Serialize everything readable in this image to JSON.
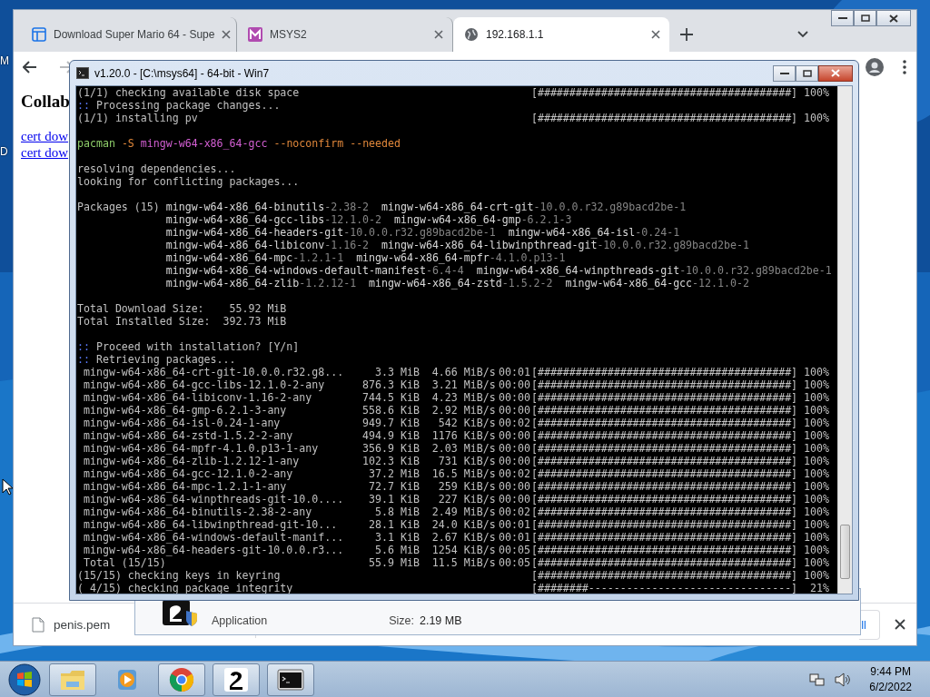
{
  "desktop": {
    "labels": [
      "M",
      "D"
    ]
  },
  "browser": {
    "tabs": [
      {
        "title": "Download Super Mario 64 - Supe",
        "kind": "page",
        "selected": false
      },
      {
        "title": "MSYS2",
        "kind": "msys",
        "selected": false
      },
      {
        "title": "192.168.1.1",
        "kind": "globe",
        "selected": true
      }
    ],
    "page": {
      "heading": "Collab",
      "links": [
        "cert dow",
        "cert dow"
      ]
    },
    "download_bar": {
      "file": "penis.pem",
      "button": "ll"
    }
  },
  "installer": {
    "type": "Application",
    "size_label": "Size:",
    "size": "2.19 MB"
  },
  "terminal": {
    "title": "v1.20.0 - [C:\\msys64] - 64-bit - Win7",
    "lines": [
      {
        "kind": "progress",
        "text": "(1/1) checking available disk space",
        "bar": "[########################################]",
        "percent": "100%"
      },
      {
        "kind": "info",
        "marker": "::",
        "text": "Processing package changes..."
      },
      {
        "kind": "progress",
        "text": "(1/1) installing pv",
        "bar": "[########################################]",
        "percent": "100%"
      },
      {
        "kind": "blank"
      },
      {
        "kind": "command",
        "segments": [
          {
            "text": "pacman",
            "color": "#8fcf6a"
          },
          {
            "text": "-S",
            "color": "#e0873a"
          },
          {
            "text": "mingw-w64-x86_64-gcc",
            "color": "#d35fd3"
          },
          {
            "text": "--noconfirm --needed",
            "color": "#e0873a"
          }
        ]
      },
      {
        "kind": "blank"
      },
      {
        "kind": "text",
        "text": "resolving dependencies..."
      },
      {
        "kind": "text",
        "text": "looking for conflicting packages..."
      },
      {
        "kind": "blank"
      },
      {
        "kind": "packages",
        "label": "Packages (15)",
        "rows": [
          [
            {
              "name": "mingw-w64-x86_64-binutils",
              "version": "-2.38-2"
            },
            {
              "name": "mingw-w64-x86_64-crt-git",
              "version": "-10.0.0.r32.g89bacd2be-1"
            }
          ],
          [
            {
              "name": "mingw-w64-x86_64-gcc-libs",
              "version": "-12.1.0-2"
            },
            {
              "name": "mingw-w64-x86_64-gmp",
              "version": "-6.2.1-3"
            }
          ],
          [
            {
              "name": "mingw-w64-x86_64-headers-git",
              "version": "-10.0.0.r32.g89bacd2be-1"
            },
            {
              "name": "mingw-w64-x86_64-isl",
              "version": "-0.24-1"
            }
          ],
          [
            {
              "name": "mingw-w64-x86_64-libiconv",
              "version": "-1.16-2"
            },
            {
              "name": "mingw-w64-x86_64-libwinpthread-git",
              "version": "-10.0.0.r32.g89bacd2be-1"
            }
          ],
          [
            {
              "name": "mingw-w64-x86_64-mpc",
              "version": "-1.2.1-1"
            },
            {
              "name": "mingw-w64-x86_64-mpfr",
              "version": "-4.1.0.p13-1"
            }
          ],
          [
            {
              "name": "mingw-w64-x86_64-windows-default-manifest",
              "version": "-6.4-4"
            },
            {
              "name": "mingw-w64-x86_64-winpthreads-git",
              "version": "-10.0.0.r32.g89bacd2be-1"
            }
          ],
          [
            {
              "name": "mingw-w64-x86_64-zlib",
              "version": "-1.2.12-1"
            },
            {
              "name": "mingw-w64-x86_64-zstd",
              "version": "-1.5.2-2"
            },
            {
              "name": "mingw-w64-x86_64-gcc",
              "version": "-12.1.0-2"
            }
          ]
        ]
      },
      {
        "kind": "blank"
      },
      {
        "kind": "size",
        "label": "Total Download Size:",
        "value": "55.92 MiB"
      },
      {
        "kind": "size",
        "label": "Total Installed Size:",
        "value": "392.73 MiB"
      },
      {
        "kind": "blank"
      },
      {
        "kind": "info",
        "marker": "::",
        "text": "Proceed with installation? [Y/n]"
      },
      {
        "kind": "info",
        "marker": "::",
        "text": "Retrieving packages..."
      },
      {
        "kind": "download",
        "name": "mingw-w64-x86_64-crt-git-10.0.0.r32.g8...",
        "size": "3.3 MiB",
        "speed": "4.66 MiB/s",
        "time": "00:01",
        "bar": "[########################################]",
        "percent": "100%"
      },
      {
        "kind": "download",
        "name": "mingw-w64-x86_64-gcc-libs-12.1.0-2-any",
        "size": "876.3 KiB",
        "speed": "3.21 MiB/s",
        "time": "00:00",
        "bar": "[########################################]",
        "percent": "100%"
      },
      {
        "kind": "download",
        "name": "mingw-w64-x86_64-libiconv-1.16-2-any",
        "size": "744.5 KiB",
        "speed": "4.23 MiB/s",
        "time": "00:00",
        "bar": "[########################################]",
        "percent": "100%"
      },
      {
        "kind": "download",
        "name": "mingw-w64-x86_64-gmp-6.2.1-3-any",
        "size": "558.6 KiB",
        "speed": "2.92 MiB/s",
        "time": "00:00",
        "bar": "[########################################]",
        "percent": "100%"
      },
      {
        "kind": "download",
        "name": "mingw-w64-x86_64-isl-0.24-1-any",
        "size": "949.7 KiB",
        "speed": "542 KiB/s",
        "time": "00:02",
        "bar": "[########################################]",
        "percent": "100%"
      },
      {
        "kind": "download",
        "name": "mingw-w64-x86_64-zstd-1.5.2-2-any",
        "size": "494.9 KiB",
        "speed": "1176 KiB/s",
        "time": "00:00",
        "bar": "[########################################]",
        "percent": "100%"
      },
      {
        "kind": "download",
        "name": "mingw-w64-x86_64-mpfr-4.1.0.p13-1-any",
        "size": "356.9 KiB",
        "speed": "2.03 MiB/s",
        "time": "00:00",
        "bar": "[########################################]",
        "percent": "100%"
      },
      {
        "kind": "download",
        "name": "mingw-w64-x86_64-zlib-1.2.12-1-any",
        "size": "102.3 KiB",
        "speed": "731 KiB/s",
        "time": "00:00",
        "bar": "[########################################]",
        "percent": "100%"
      },
      {
        "kind": "download",
        "name": "mingw-w64-x86_64-gcc-12.1.0-2-any",
        "size": "37.2 MiB",
        "speed": "16.5 MiB/s",
        "time": "00:02",
        "bar": "[########################################]",
        "percent": "100%"
      },
      {
        "kind": "download",
        "name": "mingw-w64-x86_64-mpc-1.2.1-1-any",
        "size": "72.7 KiB",
        "speed": "259 KiB/s",
        "time": "00:00",
        "bar": "[########################################]",
        "percent": "100%"
      },
      {
        "kind": "download",
        "name": "mingw-w64-x86_64-winpthreads-git-10.0....",
        "size": "39.1 KiB",
        "speed": "227 KiB/s",
        "time": "00:00",
        "bar": "[########################################]",
        "percent": "100%"
      },
      {
        "kind": "download",
        "name": "mingw-w64-x86_64-binutils-2.38-2-any",
        "size": "5.8 MiB",
        "speed": "2.49 MiB/s",
        "time": "00:02",
        "bar": "[########################################]",
        "percent": "100%"
      },
      {
        "kind": "download",
        "name": "mingw-w64-x86_64-libwinpthread-git-10...",
        "size": "28.1 KiB",
        "speed": "24.0 KiB/s",
        "time": "00:01",
        "bar": "[########################################]",
        "percent": "100%"
      },
      {
        "kind": "download",
        "name": "mingw-w64-x86_64-windows-default-manif...",
        "size": "3.1 KiB",
        "speed": "2.67 KiB/s",
        "time": "00:01",
        "bar": "[########################################]",
        "percent": "100%"
      },
      {
        "kind": "download",
        "name": "mingw-w64-x86_64-headers-git-10.0.0.r3...",
        "size": "5.6 MiB",
        "speed": "1254 KiB/s",
        "time": "00:05",
        "bar": "[########################################]",
        "percent": "100%"
      },
      {
        "kind": "download",
        "name": "Total (15/15)",
        "size": "55.9 MiB",
        "speed": "11.5 MiB/s",
        "time": "00:05",
        "bar": "[########################################]",
        "percent": "100%"
      },
      {
        "kind": "progress",
        "text": "(15/15) checking keys in keyring",
        "bar": "[########################################]",
        "percent": "100%"
      },
      {
        "kind": "progress",
        "text": "( 4/15) checking package integrity",
        "bar": "[########--------------------------------]",
        "percent": "21%"
      }
    ]
  },
  "taskbar": {
    "apps": [
      {
        "kind": "explorer",
        "running": true
      },
      {
        "kind": "media",
        "running": false
      },
      {
        "kind": "chrome",
        "running": true
      },
      {
        "kind": "numbered",
        "running": true
      },
      {
        "kind": "console",
        "running": true
      }
    ],
    "clock": {
      "time": "9:44 PM",
      "date": "6/2/2022"
    }
  }
}
